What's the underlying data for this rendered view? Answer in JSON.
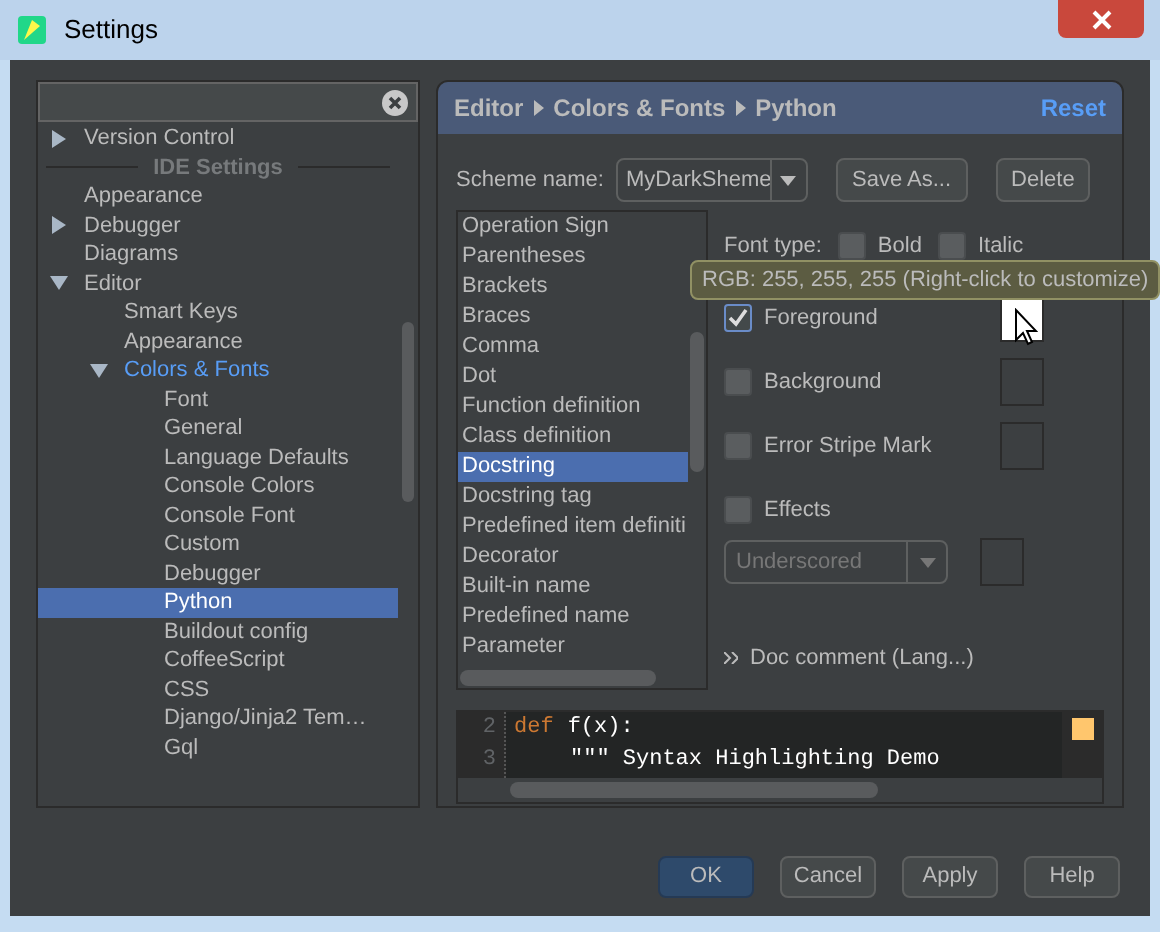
{
  "window": {
    "title": "Settings"
  },
  "tree": [
    {
      "label": "Version Control",
      "kind": "item",
      "expanded": false,
      "selected": false,
      "highlighted": false
    },
    {
      "label": "IDE Settings",
      "kind": "separator"
    },
    {
      "label": "Appearance",
      "kind": "item",
      "selected": false,
      "highlighted": false
    },
    {
      "label": "Debugger",
      "kind": "item",
      "expanded": false,
      "selected": false,
      "highlighted": false
    },
    {
      "label": "Diagrams",
      "kind": "item",
      "selected": false,
      "highlighted": false
    },
    {
      "label": "Editor",
      "kind": "item",
      "expanded": true,
      "selected": false,
      "highlighted": false,
      "children": [
        {
          "label": "Smart Keys",
          "kind": "item",
          "selected": false,
          "highlighted": false
        },
        {
          "label": "Appearance",
          "kind": "item",
          "selected": false,
          "highlighted": false
        },
        {
          "label": "Colors & Fonts",
          "kind": "item",
          "expanded": true,
          "selected": false,
          "highlighted": true,
          "children": [
            {
              "label": "Font",
              "kind": "item",
              "selected": false,
              "highlighted": false
            },
            {
              "label": "General",
              "kind": "item",
              "selected": false,
              "highlighted": false
            },
            {
              "label": "Language Defaults",
              "kind": "item",
              "selected": false,
              "highlighted": false
            },
            {
              "label": "Console Colors",
              "kind": "item",
              "selected": false,
              "highlighted": false
            },
            {
              "label": "Console Font",
              "kind": "item",
              "selected": false,
              "highlighted": false
            },
            {
              "label": "Custom",
              "kind": "item",
              "selected": false,
              "highlighted": false
            },
            {
              "label": "Debugger",
              "kind": "item",
              "selected": false,
              "highlighted": false
            },
            {
              "label": "Python",
              "kind": "item",
              "selected": true,
              "highlighted": false
            },
            {
              "label": "Buildout config",
              "kind": "item",
              "selected": false,
              "highlighted": false
            },
            {
              "label": "CoffeeScript",
              "kind": "item",
              "selected": false,
              "highlighted": false
            },
            {
              "label": "CSS",
              "kind": "item",
              "selected": false,
              "highlighted": false
            },
            {
              "label": "Django/Jinja2 Tem…",
              "kind": "item",
              "selected": false,
              "highlighted": false
            },
            {
              "label": "Gql",
              "kind": "item",
              "selected": false,
              "highlighted": false
            }
          ]
        }
      ]
    }
  ],
  "header": {
    "breadcrumb": [
      "Editor",
      "Colors & Fonts",
      "Python"
    ],
    "reset": "Reset"
  },
  "scheme": {
    "label": "Scheme name:",
    "value": "MyDarkSheme",
    "buttons": [
      "Save As...",
      "Delete"
    ]
  },
  "attributes": [
    {
      "label": "Operation Sign",
      "selected": false
    },
    {
      "label": "Parentheses",
      "selected": false
    },
    {
      "label": "Brackets",
      "selected": false
    },
    {
      "label": "Braces",
      "selected": false
    },
    {
      "label": "Comma",
      "selected": false
    },
    {
      "label": "Dot",
      "selected": false
    },
    {
      "label": "Function definition",
      "selected": false
    },
    {
      "label": "Class definition",
      "selected": false
    },
    {
      "label": "Docstring",
      "selected": true
    },
    {
      "label": "Docstring tag",
      "selected": false
    },
    {
      "label": "Predefined item definiti",
      "selected": false
    },
    {
      "label": "Decorator",
      "selected": false
    },
    {
      "label": "Built-in name",
      "selected": false
    },
    {
      "label": "Predefined name",
      "selected": false
    },
    {
      "label": "Parameter",
      "selected": false
    }
  ],
  "font_type": {
    "label": "Font type:",
    "options": [
      {
        "label": "Bold",
        "checked": false
      },
      {
        "label": "Italic",
        "checked": false
      }
    ]
  },
  "tooltip": "RGB: 255, 255, 255 (Right-click to customize)",
  "color_options": [
    {
      "label": "Foreground",
      "checked": true,
      "color": "#ffffff"
    },
    {
      "label": "Background",
      "checked": false
    },
    {
      "label": "Error Stripe Mark",
      "checked": false
    },
    {
      "label": "Effects",
      "checked": false
    }
  ],
  "effect": {
    "value": "Underscored",
    "disabled": true
  },
  "inherit_link": "Doc comment (Lang...)",
  "preview": [
    {
      "number": "2",
      "tokens": [
        {
          "kind": "keyword",
          "text": "def"
        },
        {
          "kind": "plain",
          "text": "f(x):"
        }
      ]
    },
    {
      "number": "3",
      "tokens": [
        {
          "kind": "plain",
          "text": "\"\"\" Syntax Highlighting Demo"
        }
      ]
    }
  ],
  "preview_marker": {
    "color": "#ffc66d"
  },
  "buttons": [
    {
      "label": "OK",
      "default": true
    },
    {
      "label": "Cancel",
      "default": false
    },
    {
      "label": "Apply",
      "default": false
    },
    {
      "label": "Help",
      "default": false
    }
  ]
}
